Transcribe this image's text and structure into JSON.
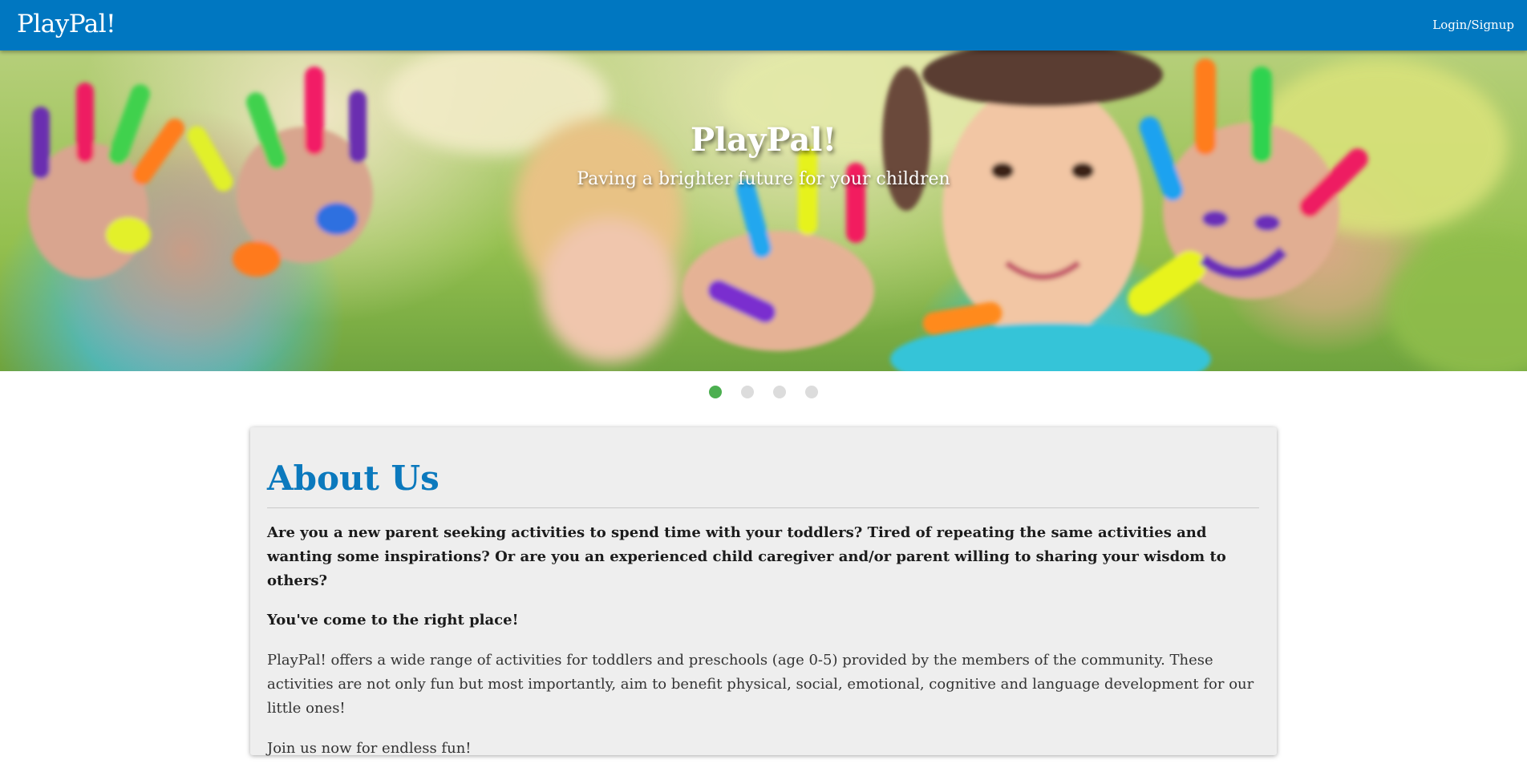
{
  "navbar": {
    "brand": "PlayPal!",
    "login_label": "Login/Signup"
  },
  "hero": {
    "title": "PlayPal!",
    "subtitle": "Paving a brighter future for your children",
    "slides_total": 4,
    "active_slide": 1
  },
  "about": {
    "heading": "About Us",
    "intro": "Are you a new parent seeking activities to spend time with your toddlers? Tired of repeating the same activities and wanting some inspirations? Or are you an experienced child caregiver and/or parent willing to sharing your wisdom to others?",
    "right_place": "You've come to the right place!",
    "description": "PlayPal! offers a wide range of activities for toddlers and preschools (age 0-5) provided by the members of the community. These activities are not only fun but most importantly, aim to benefit physical, social, emotional, cognitive and language development for our little ones!",
    "join": "Join us now for endless fun!"
  },
  "colors": {
    "navbar": "#0077c1",
    "heading": "#0b79bd",
    "active_dot": "#4caf50",
    "inactive_dot": "#dcdcdc",
    "card_bg": "#eeeeee"
  }
}
